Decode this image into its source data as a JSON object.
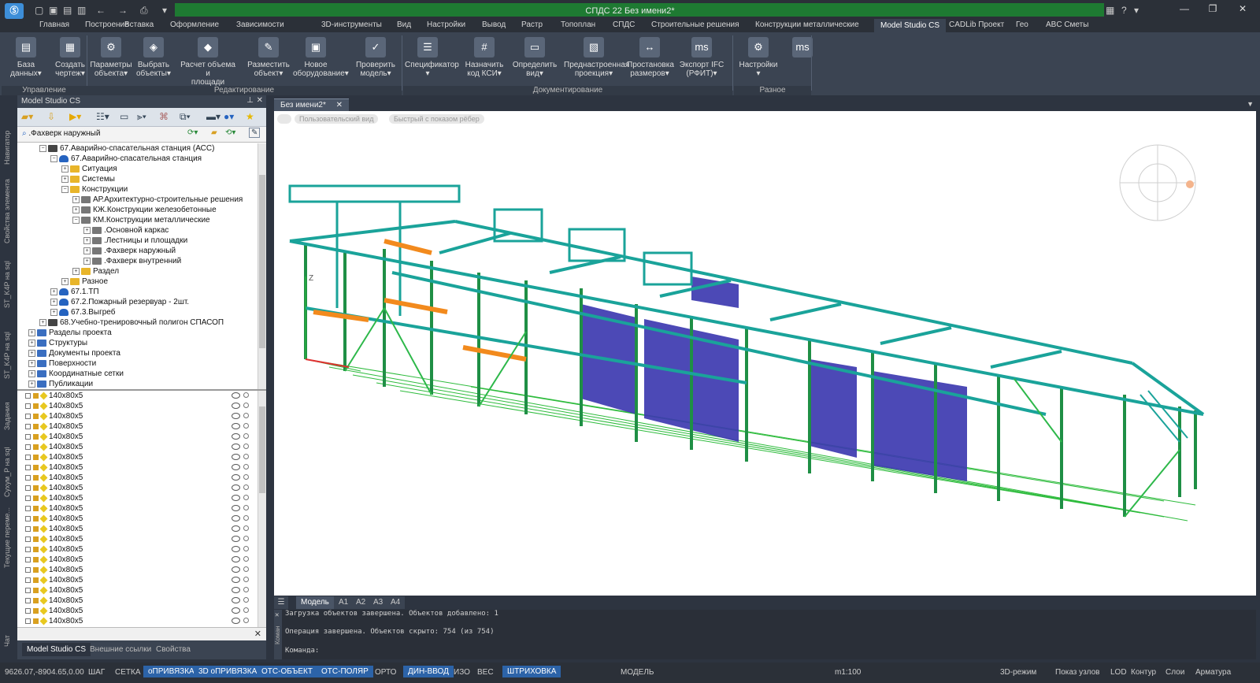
{
  "app": {
    "title": "СПДС 22 Без имени2*",
    "help": "?"
  },
  "menu": [
    "Главная",
    "Построение",
    "Вставка",
    "Оформление",
    "Зависимости",
    "3D-инструменты",
    "Вид",
    "Настройки",
    "Вывод",
    "Растр",
    "Топоплан",
    "СПДС",
    "Строительные решения",
    "Конструкции металлические",
    "Model Studio CS",
    "CADLib Проект",
    "Гео",
    "ABC Сметы"
  ],
  "ribbon": {
    "buttons": [
      {
        "l1": "База",
        "l2": "данных▾",
        "icon": "▤"
      },
      {
        "l1": "Создать",
        "l2": "чертеж▾",
        "icon": "▦"
      },
      {
        "l1": "Параметры",
        "l2": "объекта▾",
        "icon": "⚙"
      },
      {
        "l1": "Выбрать",
        "l2": "объекты▾",
        "icon": "◈"
      },
      {
        "l1": "Расчет объема и",
        "l2": "площади объекта▾",
        "icon": "◆"
      },
      {
        "l1": "Разместить",
        "l2": "объект▾",
        "icon": "✎"
      },
      {
        "l1": "Новое",
        "l2": "оборудование▾",
        "icon": "▣"
      },
      {
        "l1": "Проверить",
        "l2": "модель▾",
        "icon": "✓"
      },
      {
        "l1": "Спецификатор",
        "l2": "▾",
        "icon": "☰"
      },
      {
        "l1": "Назначить",
        "l2": "код КСИ▾",
        "icon": "#"
      },
      {
        "l1": "Определить",
        "l2": "вид▾",
        "icon": "▭"
      },
      {
        "l1": "Преднастроенная",
        "l2": "проекция▾",
        "icon": "▧"
      },
      {
        "l1": "Простановка",
        "l2": "размеров▾",
        "icon": "↔"
      },
      {
        "l1": "Экспорт IFC",
        "l2": "(РФИТ)▾",
        "icon": "ms"
      },
      {
        "l1": "Настройки",
        "l2": "▾",
        "icon": "⚙"
      },
      {
        "l1": "",
        "l2": "",
        "icon": "ms"
      }
    ],
    "groups": [
      "Управление",
      "Редактирование",
      "Документирование",
      "Разное"
    ]
  },
  "panel": {
    "title": "Model Studio CS",
    "search": ".Фахверк наружный",
    "tree": [
      {
        "indent": 2,
        "exp": "−",
        "icon": "node",
        "label": "67.Аварийно-спасательная станция (АСС)"
      },
      {
        "indent": 3,
        "exp": "−",
        "icon": "blue",
        "label": "67.Аварийно-спасательная станция"
      },
      {
        "indent": 4,
        "exp": "+",
        "icon": "folder",
        "label": "Ситуация"
      },
      {
        "indent": 4,
        "exp": "+",
        "icon": "folder",
        "label": "Системы"
      },
      {
        "indent": 4,
        "exp": "−",
        "icon": "folder",
        "label": "Конструкции"
      },
      {
        "indent": 5,
        "exp": "+",
        "icon": "gray",
        "label": "АР.Архитектурно-строительные решения"
      },
      {
        "indent": 5,
        "exp": "+",
        "icon": "gray",
        "label": "КЖ.Конструкции железобетонные"
      },
      {
        "indent": 5,
        "exp": "−",
        "icon": "gray",
        "label": "КМ.Конструкции металлические"
      },
      {
        "indent": 6,
        "exp": "+",
        "icon": "gray",
        "label": ".Основной каркас"
      },
      {
        "indent": 6,
        "exp": "+",
        "icon": "gray",
        "label": ".Лестницы и площадки"
      },
      {
        "indent": 6,
        "exp": "+",
        "icon": "gray",
        "label": ".Фахверк наружный"
      },
      {
        "indent": 6,
        "exp": "+",
        "icon": "gray",
        "label": ".Фахверк внутренний"
      },
      {
        "indent": 5,
        "exp": "+",
        "icon": "folder",
        "label": "Раздел"
      },
      {
        "indent": 4,
        "exp": "+",
        "icon": "folder",
        "label": "Разное"
      },
      {
        "indent": 3,
        "exp": "+",
        "icon": "blue",
        "label": "67.1.ТП"
      },
      {
        "indent": 3,
        "exp": "+",
        "icon": "blue",
        "label": "67.2.Пожарный резервуар - 2шт."
      },
      {
        "indent": 3,
        "exp": "+",
        "icon": "blue",
        "label": "67.3.Выгреб"
      },
      {
        "indent": 2,
        "exp": "+",
        "icon": "node",
        "label": "68.Учебно-тренировочный полигон СПАСОП"
      },
      {
        "indent": 1,
        "exp": "+",
        "icon": "grid",
        "label": "Разделы проекта"
      },
      {
        "indent": 1,
        "exp": "+",
        "icon": "grid",
        "label": "Структуры"
      },
      {
        "indent": 1,
        "exp": "+",
        "icon": "grid",
        "label": "Документы проекта"
      },
      {
        "indent": 1,
        "exp": "+",
        "icon": "grid",
        "label": "Поверхности"
      },
      {
        "indent": 1,
        "exp": "+",
        "icon": "grid",
        "label": "Координатные сетки"
      },
      {
        "indent": 1,
        "exp": "+",
        "icon": "grid",
        "label": "Публикации"
      }
    ],
    "list_items": [
      "140x80x5",
      "140x80x5",
      "140x80x5",
      "140x80x5",
      "140x80x5",
      "140x80x5",
      "140x80x5",
      "140x80x5",
      "140x80x5",
      "140x80x5",
      "140x80x5",
      "140x80x5",
      "140x80x5",
      "140x80x5",
      "140x80x5",
      "140x80x5",
      "140x80x5",
      "140x80x5",
      "140x80x5",
      "140x80x5",
      "140x80x5",
      "140x80x5",
      "140x80x5"
    ],
    "bottom_tabs": [
      "Model Studio CS",
      "Внешние ссылки",
      "Свойства"
    ]
  },
  "side_tabs": [
    "Навигатор",
    "Свойства элемента",
    "ST_K4P на sql",
    "ST_K4P на sql",
    "Задания",
    "Сухум_Р на sql",
    "Текущие переме...",
    "Чат"
  ],
  "document": {
    "tab": "Без имени2*",
    "view_tags": [
      "Пользовательский вид",
      "Быстрый с показом рёбер"
    ],
    "layout_tabs": [
      "Модель",
      "A1",
      "A2",
      "A3",
      "A4"
    ]
  },
  "command": {
    "lines": [
      "Загрузка объектов завершена. Объектов добавлено: 1",
      "Операция завершена. Объектов скрыто: 754 (из 754)",
      "Команда:"
    ],
    "side_label": "Коман"
  },
  "status": {
    "coords": "9626.07,-8904.65,0.00",
    "toggles": [
      {
        "label": "ШАГ",
        "on": false
      },
      {
        "label": "СЕТКА",
        "on": false
      },
      {
        "label": "оПРИВЯЗКА",
        "on": true
      },
      {
        "label": "3D оПРИВЯЗКА",
        "on": true
      },
      {
        "label": "ОТС-ОБЪЕКТ",
        "on": true
      },
      {
        "label": "ОТС-ПОЛЯР",
        "on": true
      },
      {
        "label": "ОРТО",
        "on": false
      },
      {
        "label": "ДИН-ВВОД",
        "on": true
      },
      {
        "label": "ИЗО",
        "on": false
      },
      {
        "label": "ВЕС",
        "on": false
      },
      {
        "label": "ШТРИХОВКА",
        "on": true
      }
    ],
    "model": "МОДЕЛЬ",
    "scale": "m1:100",
    "right": [
      "3D-режим",
      "Показ узлов",
      "LOD",
      "Контур",
      "Слои",
      "Арматура"
    ]
  },
  "colors": {
    "accent": "#2c63a8",
    "title_green": "#1e7a32",
    "steel_teal": "#1aa39a",
    "steel_green": "#2db84a",
    "cladding": "#3d3ab0",
    "orange": "#f28a1d"
  }
}
